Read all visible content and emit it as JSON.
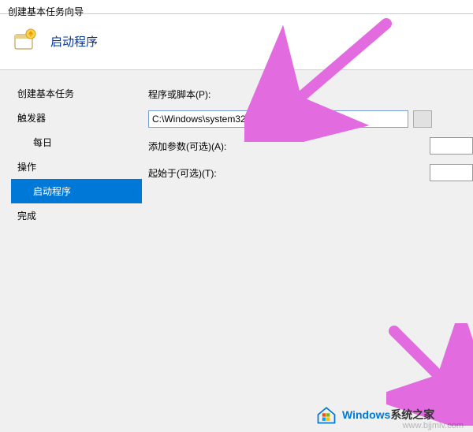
{
  "window": {
    "title": "创建基本任务向导"
  },
  "header": {
    "title": "启动程序"
  },
  "sidebar": {
    "items": [
      {
        "label": "创建基本任务"
      },
      {
        "label": "触发器"
      },
      {
        "label": "每日"
      },
      {
        "label": "操作"
      },
      {
        "label": "启动程序"
      },
      {
        "label": "完成"
      }
    ]
  },
  "main": {
    "program_label": "程序或脚本(P):",
    "program_value": "C:\\Windows\\system32\\shutdown.exe -s",
    "browse_label": "",
    "args_label": "添加参数(可选)(A):",
    "args_value": "",
    "startin_label": "起始于(可选)(T):",
    "startin_value": ""
  },
  "watermark": {
    "brand_blue": "Windows",
    "brand_rest": "系统之家",
    "url": "www.bjjmlv.com"
  },
  "colors": {
    "accent": "#0078d7",
    "arrow": "#e26be0"
  }
}
